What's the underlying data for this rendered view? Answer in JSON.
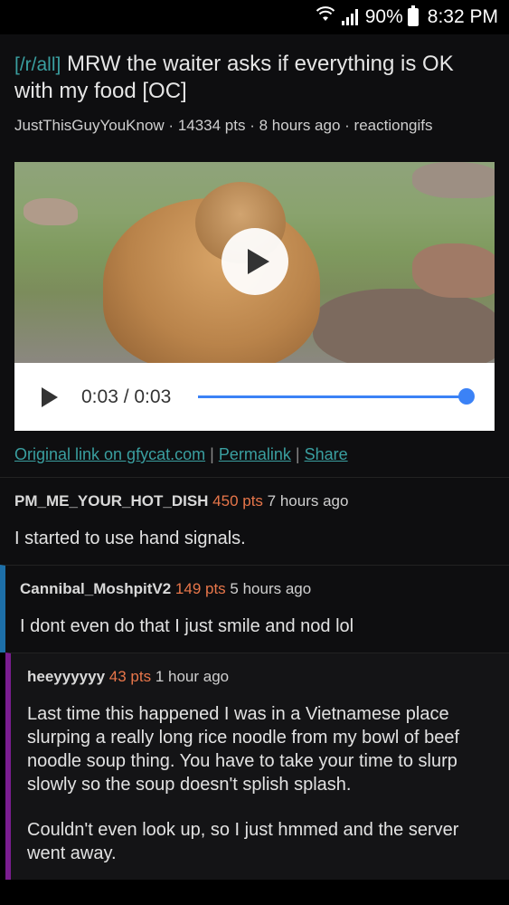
{
  "status_bar": {
    "battery": "90%",
    "time": "8:32 PM"
  },
  "post": {
    "subreddit": "[/r/all]",
    "title": "MRW the waiter asks if everything is OK with my food [OC]",
    "author": "JustThisGuyYouKnow",
    "points": "14334 pts",
    "age": "8 hours ago",
    "domain": "reactiongifs",
    "video": {
      "time": "0:03 / 0:03",
      "progress": 1.0
    },
    "links": {
      "original": "Original link on gfycat.com",
      "permalink": "Permalink",
      "share": "Share",
      "separator": "|"
    }
  },
  "comments": [
    {
      "author": "PM_ME_YOUR_HOT_DISH",
      "points": "450 pts",
      "age": "7 hours ago",
      "body": [
        "I started to use hand signals."
      ]
    },
    {
      "author": "Cannibal_MoshpitV2",
      "points": "149 pts",
      "age": "5 hours ago",
      "body": [
        "I dont even do that I just smile and nod lol"
      ]
    },
    {
      "author": "heeyyyyyy",
      "points": "43 pts",
      "age": "1 hour ago",
      "body": [
        "Last time this happened I was in a Vietnamese place slurping a really long rice noodle from my bowl of beef noodle soup thing. You have to take your time to slurp slowly so the soup doesn't splish splash.",
        "Couldn't even look up, so I just hmmed and the server went away."
      ]
    }
  ],
  "colors": {
    "subreddit_link": "#3a9fa0",
    "points": "#e8764a",
    "progress": "#3b82f6",
    "depth1_bar": "#1d6fa8",
    "depth2_bar": "#7a1d8f"
  }
}
